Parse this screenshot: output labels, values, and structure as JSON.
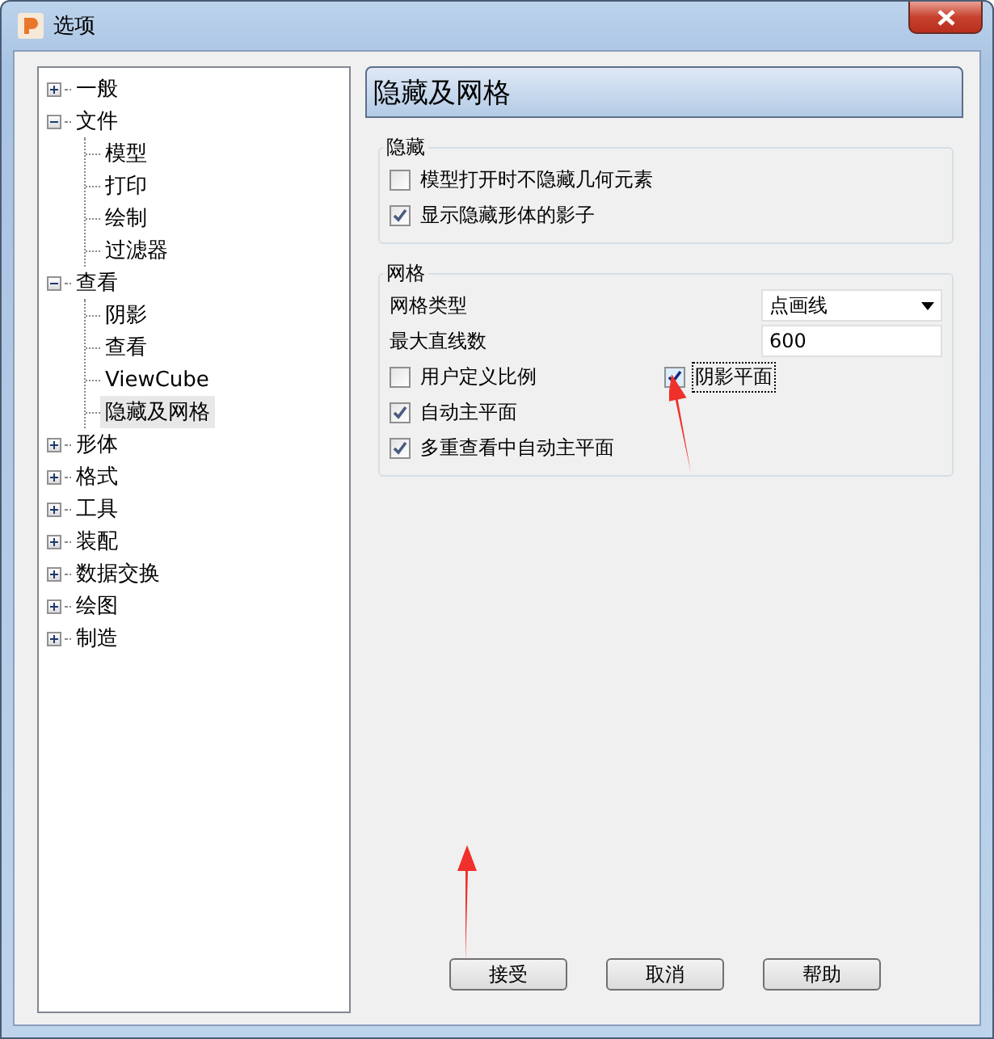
{
  "window": {
    "title": "选项"
  },
  "tree": [
    {
      "label": "一般",
      "expanded": false,
      "selected": false
    },
    {
      "label": "文件",
      "expanded": true,
      "selected": false,
      "children": [
        {
          "label": "模型",
          "selected": false
        },
        {
          "label": "打印",
          "selected": false
        },
        {
          "label": "绘制",
          "selected": false
        },
        {
          "label": "过滤器",
          "selected": false
        }
      ]
    },
    {
      "label": "查看",
      "expanded": true,
      "selected": false,
      "children": [
        {
          "label": "阴影",
          "selected": false
        },
        {
          "label": "查看",
          "selected": false
        },
        {
          "label": "ViewCube",
          "selected": false
        },
        {
          "label": "隐藏及网格",
          "selected": true
        }
      ]
    },
    {
      "label": "形体",
      "expanded": false,
      "selected": false
    },
    {
      "label": "格式",
      "expanded": false,
      "selected": false
    },
    {
      "label": "工具",
      "expanded": false,
      "selected": false
    },
    {
      "label": "装配",
      "expanded": false,
      "selected": false
    },
    {
      "label": "数据交换",
      "expanded": false,
      "selected": false
    },
    {
      "label": "绘图",
      "expanded": false,
      "selected": false
    },
    {
      "label": "制造",
      "expanded": false,
      "selected": false
    }
  ],
  "page_title": "隐藏及网格",
  "hide_group": {
    "title": "隐藏",
    "checkboxes": [
      {
        "label": "模型打开时不隐藏几何元素",
        "checked": false,
        "focused": false
      },
      {
        "label": "显示隐藏形体的影子",
        "checked": true,
        "focused": false
      }
    ]
  },
  "grid_group": {
    "title": "网格",
    "fields": [
      {
        "label": "网格类型",
        "kind": "dropdown",
        "value": "点画线"
      },
      {
        "label": "最大直线数",
        "kind": "text",
        "value": "600"
      }
    ],
    "checkbox_rows": [
      [
        {
          "label": "用户定义比例",
          "checked": false,
          "focused": false
        },
        {
          "label": "阴影平面",
          "checked": true,
          "focused": true
        }
      ],
      [
        {
          "label": "自动主平面",
          "checked": true,
          "focused": false
        }
      ],
      [
        {
          "label": "多重查看中自动主平面",
          "checked": true,
          "focused": false
        }
      ]
    ]
  },
  "buttons": [
    "接受",
    "取消",
    "帮助"
  ]
}
